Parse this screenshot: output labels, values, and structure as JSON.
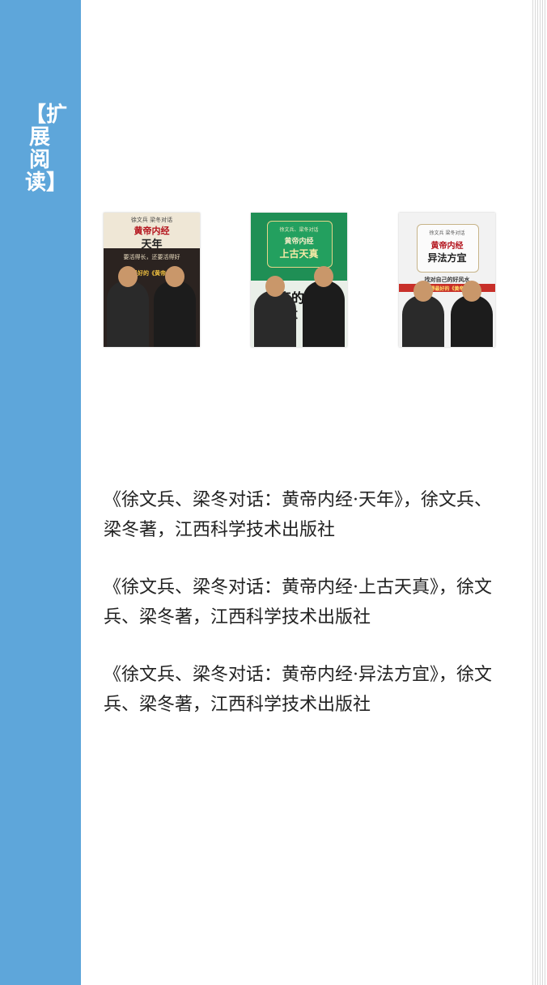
{
  "sidebar": {
    "title": "【扩展阅读】",
    "color": "#5ea6da"
  },
  "covers": [
    {
      "top_text": "徐文兵 梁冬对话",
      "title": "黄帝内经",
      "subtitle": "天年",
      "tagline": "要活得长，还要活得好",
      "banner": "讲得最好的《黄帝内经》",
      "background": "#2b2320"
    },
    {
      "top_text": "徐文兵、梁冬对话",
      "title": "黄帝内经",
      "subtitle": "上古天真",
      "big_text": "天真的力量",
      "background": "#1f8f55"
    },
    {
      "top_text": "徐文兵 梁冬对话",
      "title": "黄帝内经",
      "subtitle": "异法方宜",
      "tagline": "找对自己的好风水",
      "banner": "当今讲得最好的《黄帝内经》",
      "background": "#f2f2f2"
    }
  ],
  "books": [
    {
      "text": "《徐文兵、梁冬对话：黄帝内经·天年》，徐文兵、梁冬著，江西科学技术出版社"
    },
    {
      "text": "《徐文兵、梁冬对话：黄帝内经·上古天真》，徐文兵、梁冬著，江西科学技术出版社"
    },
    {
      "text": "《徐文兵、梁冬对话：黄帝内经·异法方宜》，徐文兵、梁冬著，江西科学技术出版社"
    }
  ]
}
